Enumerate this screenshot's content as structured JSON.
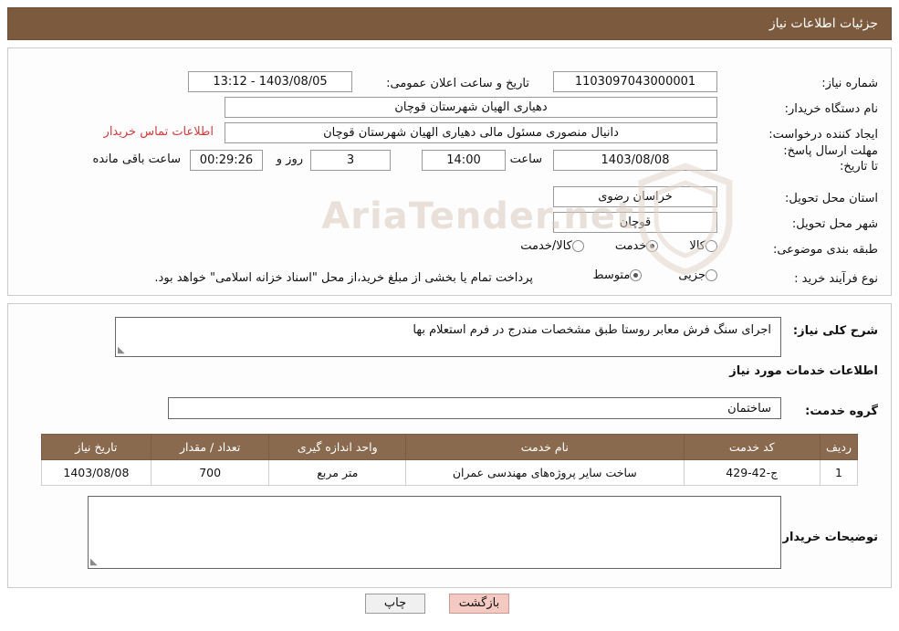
{
  "header": {
    "title": "جزئیات اطلاعات نیاز"
  },
  "watermark": {
    "text": "AriaTender.net"
  },
  "form": {
    "need_number_label": "شماره نیاز:",
    "need_number_value": "1103097043000001",
    "announce_datetime_label": "تاریخ و ساعت اعلان عمومی:",
    "announce_datetime_value": "13:12 - 1403/08/05",
    "buyer_org_label": "نام دستگاه خریدار:",
    "buyer_org_value": "دهیاری الهیان  شهرستان قوچان",
    "requester_label": "ایجاد کننده درخواست:",
    "requester_value": "دانیال منصوری مسئول مالی  دهیاری الهیان  شهرستان قوچان",
    "contact_link": "اطلاعات تماس خریدار",
    "deadline_label": "مهلت ارسال پاسخ: تا تاریخ:",
    "deadline_date": "1403/08/08",
    "hour_label": "ساعت",
    "deadline_time": "14:00",
    "days_value": "3",
    "days_label": "روز و",
    "countdown_value": "00:29:26",
    "countdown_label": "ساعت باقی مانده",
    "province_label": "استان محل تحویل:",
    "province_value": "خراسان رضوی",
    "city_label": "شهر محل تحویل:",
    "city_value": "قوچان",
    "category_label": "طبقه بندی موضوعی:",
    "category_options": [
      {
        "label": "کالا",
        "checked": false
      },
      {
        "label": "خدمت",
        "checked": true
      },
      {
        "label": "کالا/خدمت",
        "checked": false
      }
    ],
    "process_label": "نوع فرآیند خرید :",
    "process_options": [
      {
        "label": "جزیی",
        "checked": false
      },
      {
        "label": "متوسط",
        "checked": true
      }
    ],
    "process_note": "پرداخت تمام یا بخشی از مبلغ خرید،از محل \"اسناد خزانه اسلامی\" خواهد بود."
  },
  "details": {
    "general_desc_label": "شرح کلی نیاز:",
    "general_desc_value": "اجرای سنگ فرش معابر روستا طبق مشخصات مندرج در فرم استعلام بها",
    "services_section_title": "اطلاعات خدمات مورد نیاز",
    "service_group_label": "گروه خدمت:",
    "service_group_value": "ساختمان",
    "buyer_notes_label": "توضیحات خریدار;",
    "buyer_notes_value": ""
  },
  "table": {
    "headers": [
      "ردیف",
      "کد خدمت",
      "نام خدمت",
      "واحد اندازه گیری",
      "تعداد / مقدار",
      "تاریخ نیاز"
    ],
    "rows": [
      {
        "row": "1",
        "code": "ج-42-429",
        "name": "ساخت سایر پروژه‌های مهندسی عمران",
        "unit": "متر مربع",
        "qty": "700",
        "date": "1403/08/08"
      }
    ]
  },
  "footer": {
    "print_label": "چاپ",
    "back_label": "بازگشت"
  }
}
